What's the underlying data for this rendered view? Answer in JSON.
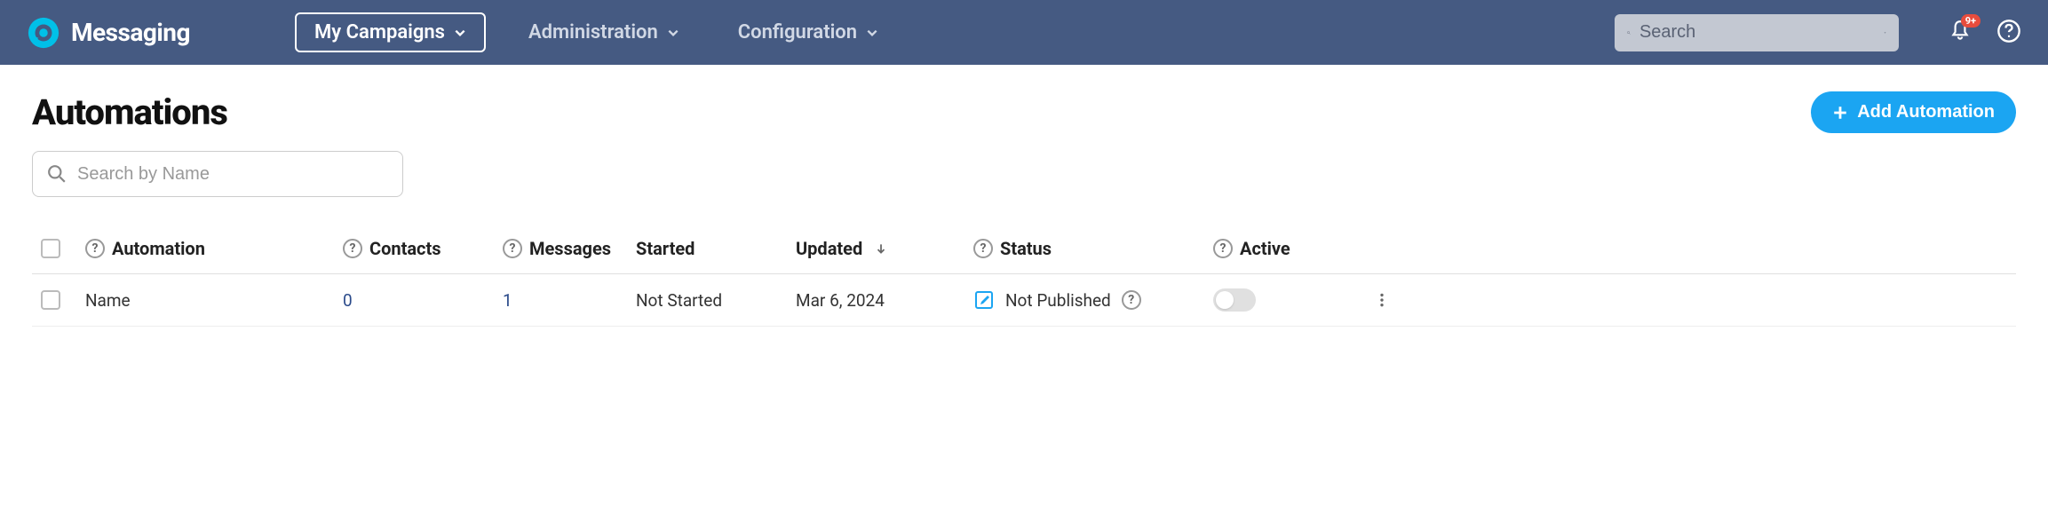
{
  "header": {
    "app_name": "Messaging",
    "nav": {
      "campaigns": "My Campaigns",
      "administration": "Administration",
      "configuration": "Configuration"
    },
    "search_placeholder": "Search",
    "notification_badge": "9+"
  },
  "page": {
    "title": "Automations",
    "add_button": "Add Automation",
    "filter_placeholder": "Search by Name"
  },
  "table": {
    "columns": {
      "automation": "Automation",
      "contacts": "Contacts",
      "messages": "Messages",
      "started": "Started",
      "updated": "Updated",
      "status": "Status",
      "active": "Active"
    },
    "rows": [
      {
        "name": "Name",
        "contacts": "0",
        "messages": "1",
        "started": "Not Started",
        "updated": "Mar 6, 2024",
        "status": "Not Published",
        "active": false
      }
    ]
  }
}
